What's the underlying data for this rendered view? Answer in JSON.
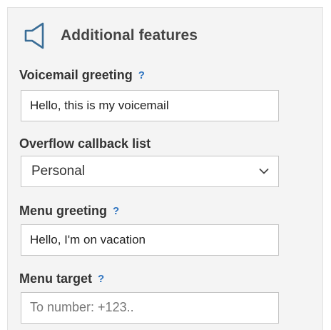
{
  "header": {
    "icon": "speaker-icon",
    "title": "Additional features"
  },
  "fields": {
    "voicemail_greeting": {
      "label": "Voicemail greeting",
      "help": "?",
      "value": "Hello, this is my voicemail"
    },
    "overflow_callback_list": {
      "label": "Overflow callback list",
      "selected": "Personal"
    },
    "menu_greeting": {
      "label": "Menu greeting",
      "help": "?",
      "value": "Hello, I'm on vacation"
    },
    "menu_target": {
      "label": "Menu target",
      "help": "?",
      "placeholder": "To number: +123.."
    }
  },
  "colors": {
    "panel_background": "#f4f4f4",
    "help_link": "#2f74c0",
    "icon_stroke": "#3a6d96"
  }
}
